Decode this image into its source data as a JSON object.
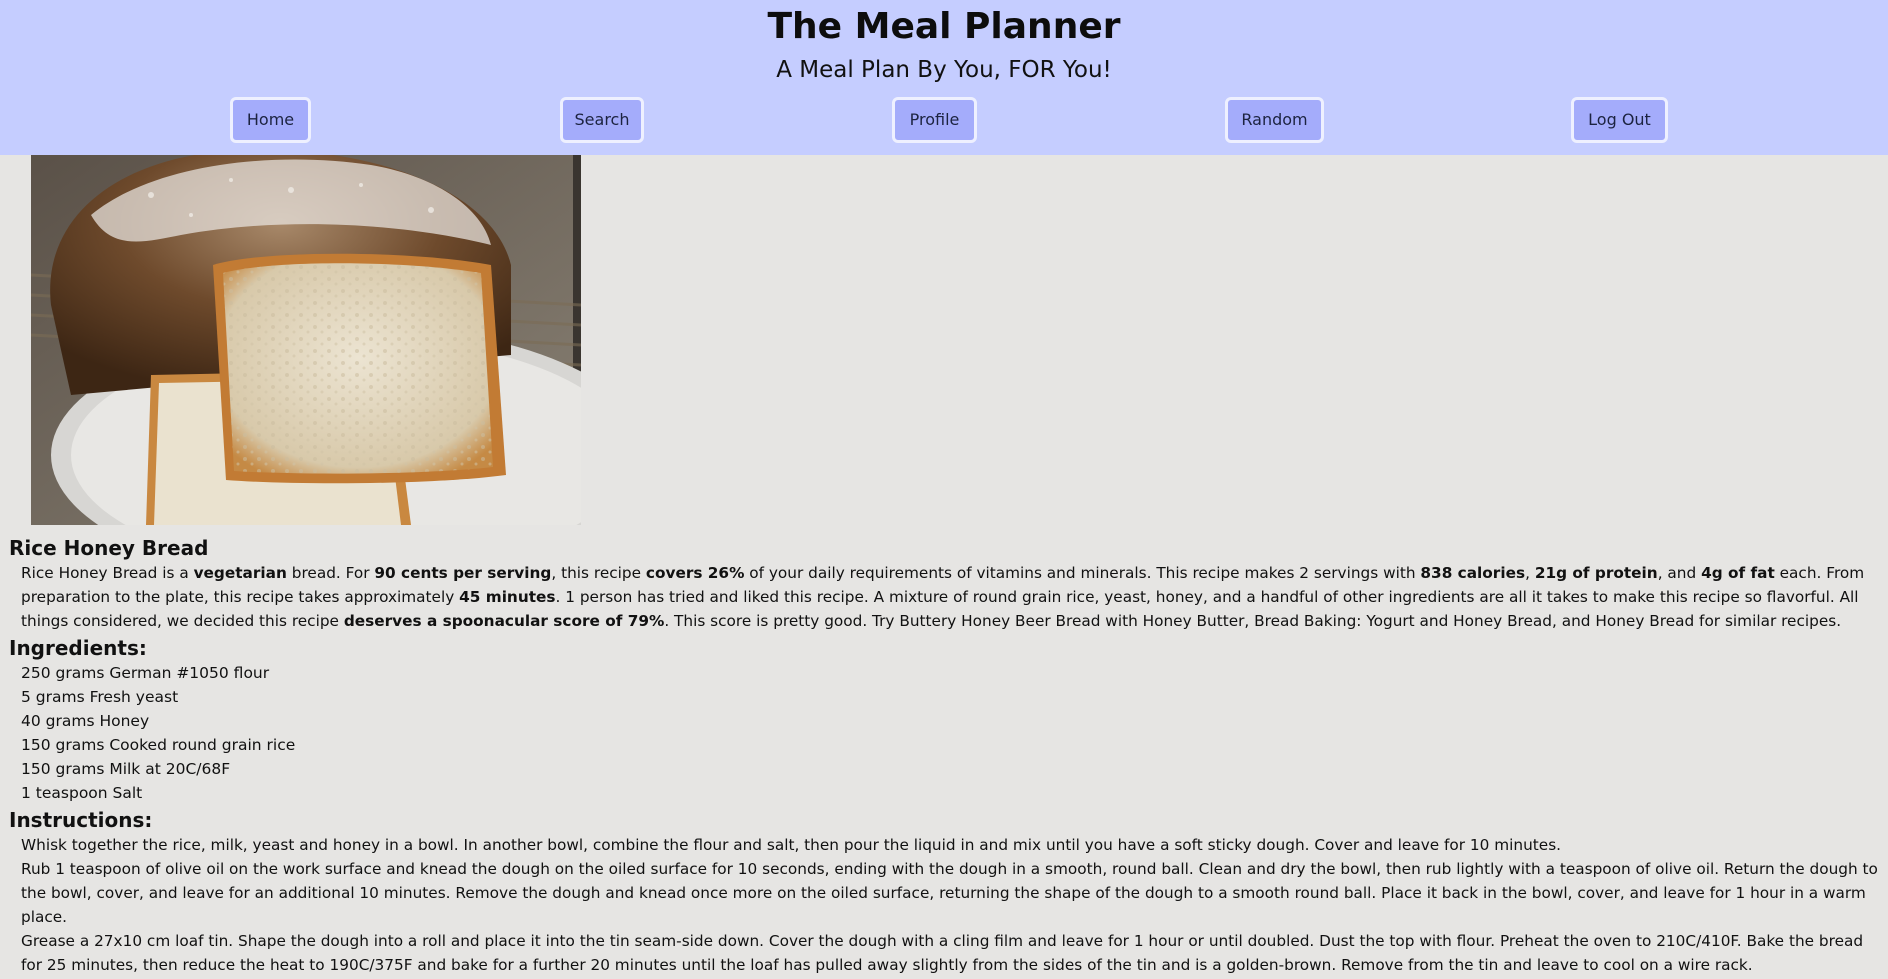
{
  "header": {
    "title": "The Meal Planner",
    "tagline": "A Meal Plan By You, FOR You!",
    "nav": [
      {
        "label": "Home",
        "name": "nav-home-button"
      },
      {
        "label": "Search",
        "name": "nav-search-button"
      },
      {
        "label": "Profile",
        "name": "nav-profile-button"
      },
      {
        "label": "Random",
        "name": "nav-random-button"
      },
      {
        "label": "Log Out",
        "name": "nav-logout-button"
      }
    ]
  },
  "colors": {
    "header_bg": "#c5cdff",
    "button_bg": "#a4acfb",
    "page_bg": "#e6e5e3"
  },
  "recipe": {
    "image_subject": "loaf of rice honey bread with slices cut",
    "title": "Rice Honey Bread",
    "summary_parts": [
      {
        "t": "Rice Honey Bread is a "
      },
      {
        "t": "vegetarian",
        "b": true
      },
      {
        "t": " bread. For "
      },
      {
        "t": "90 cents per serving",
        "b": true
      },
      {
        "t": ", this recipe "
      },
      {
        "t": "covers 26%",
        "b": true
      },
      {
        "t": " of your daily requirements of vitamins and minerals. This recipe makes 2 servings with "
      },
      {
        "t": "838 calories",
        "b": true
      },
      {
        "t": ", "
      },
      {
        "t": "21g of protein",
        "b": true
      },
      {
        "t": ", and "
      },
      {
        "t": "4g of fat",
        "b": true
      },
      {
        "t": " each. From preparation to the plate, this recipe takes approximately "
      },
      {
        "t": "45 minutes",
        "b": true
      },
      {
        "t": ". 1 person has tried and liked this recipe. A mixture of round grain rice, yeast, honey, and a handful of other ingredients are all it takes to make this recipe so flavorful. All things considered, we decided this recipe "
      },
      {
        "t": "deserves a spoonacular score of 79%",
        "b": true
      },
      {
        "t": ". This score is pretty good. Try Buttery Honey Beer Bread with Honey Butter, Bread Baking: Yogurt and Honey Bread, and Honey Bread for similar recipes."
      }
    ],
    "ingredients_heading": "Ingredients:",
    "ingredients": [
      "250 grams German #1050 flour",
      "5 grams Fresh yeast",
      "40 grams Honey",
      "150 grams Cooked round grain rice",
      "150 grams Milk at 20C/68F",
      "1 teaspoon Salt"
    ],
    "instructions_heading": "Instructions:",
    "instructions": [
      "Whisk together the rice, milk, yeast and honey in a bowl. In another bowl, combine the flour and salt, then pour the liquid in and mix until you have a soft sticky dough. Cover and leave for 10 minutes.",
      "Rub 1 teaspoon of olive oil on the work surface and knead the dough on the oiled surface for 10 seconds, ending with the dough in a smooth, round ball. Clean and dry the bowl, then rub lightly with a teaspoon of olive oil. Return the dough to the bowl, cover, and leave for an additional 10 minutes. Remove the dough and knead once more on the oiled surface, returning the shape of the dough to a smooth round ball. Place it back in the bowl, cover, and leave for 1 hour in a warm place.",
      "Grease a 27x10 cm loaf tin. Shape the dough into a roll and place it into the tin seam-side down. Cover the dough with a cling film and leave for 1 hour or until doubled. Dust the top with flour. Preheat the oven to 210C/410F. Bake the bread for 25 minutes, then reduce the heat to 190C/375F and bake for a further 20 minutes until the loaf has pulled away slightly from the sides of the tin and is a golden-brown. Remove from the tin and leave to cool on a wire rack."
    ]
  }
}
